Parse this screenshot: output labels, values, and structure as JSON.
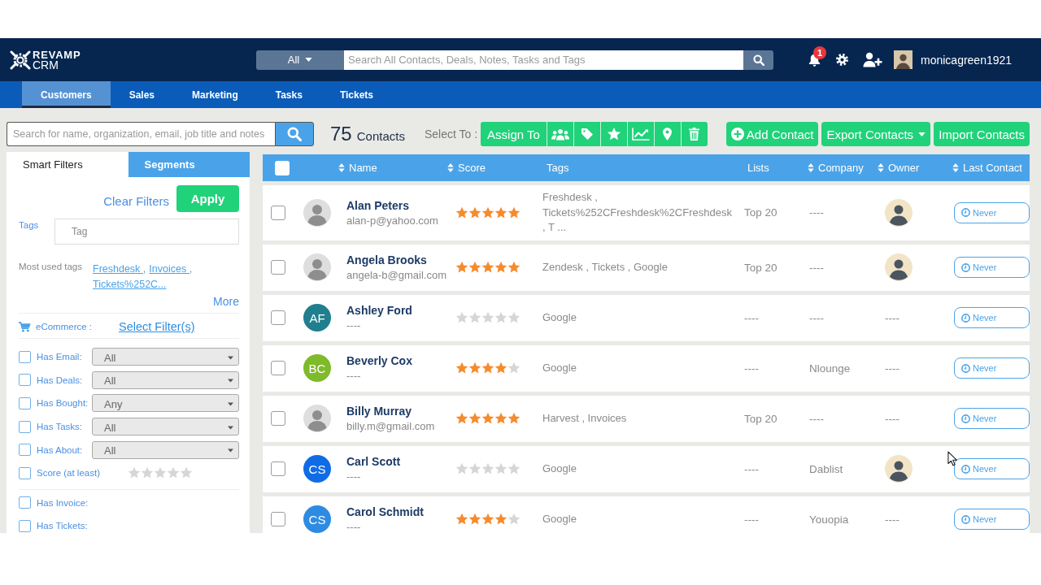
{
  "header": {
    "logo": {
      "line1": "REVAMP",
      "line2": "CRM"
    },
    "search": {
      "scope": "All",
      "placeholder": "Search All Contacts, Deals, Notes, Tasks and Tags"
    },
    "notification_count": "1",
    "username": "monicagreen1921"
  },
  "nav": {
    "tabs": [
      {
        "label": "Customers",
        "selected": true
      },
      {
        "label": "Sales",
        "selected": false
      },
      {
        "label": "Marketing",
        "selected": false
      },
      {
        "label": "Tasks",
        "selected": false
      },
      {
        "label": "Tickets",
        "selected": false
      }
    ]
  },
  "toolbar": {
    "search": {
      "placeholder": "Search for name, organization, email, job title and notes"
    },
    "count": "75",
    "count_label": "Contacts",
    "select_label": "Select To :",
    "assign_label": "Assign To",
    "actions": [
      {
        "kind": "add",
        "label": "Add Contact"
      },
      {
        "kind": "dropdown",
        "label": "Export Contacts"
      },
      {
        "kind": "plain",
        "label": "Import Contacts"
      }
    ]
  },
  "filters": {
    "tabs": [
      {
        "label": "Smart Filters",
        "selected": true
      },
      {
        "label": "Segments",
        "selected": false
      }
    ],
    "clear_label": "Clear Filters",
    "apply_label": "Apply",
    "tags": {
      "label": "Tags",
      "placeholder": "Tag"
    },
    "most_used": {
      "label": "Most used tags",
      "links": [
        "Freshdesk ,",
        "Invoices ,",
        "Tickets%252C..."
      ]
    },
    "more_label": "More",
    "ecommerce": {
      "label": "eCommerce :",
      "link": "Select Filter(s)"
    },
    "options": [
      {
        "kind": "select",
        "label": "Has Email:",
        "checked": false,
        "value": "All"
      },
      {
        "kind": "select",
        "label": "Has Deals:",
        "checked": false,
        "value": "All"
      },
      {
        "kind": "select",
        "label": "Has Bought:",
        "checked": false,
        "value": "Any"
      },
      {
        "kind": "select",
        "label": "Has Tasks:",
        "checked": false,
        "value": "All"
      },
      {
        "kind": "select",
        "label": "Has About:",
        "checked": false,
        "value": "All"
      },
      {
        "kind": "stars",
        "label": "Score (at least)",
        "checked": false,
        "stars": 0
      }
    ],
    "more_options": [
      {
        "label": "Has Invoice:",
        "checked": false
      },
      {
        "label": "Has Tickets:",
        "checked": false
      }
    ]
  },
  "table": {
    "select_all_checked": false,
    "columns": [
      {
        "label": "Name",
        "sortable": true
      },
      {
        "label": "Score",
        "sortable": true
      },
      {
        "label": "Tags",
        "sortable": false
      },
      {
        "label": "Lists",
        "sortable": false
      },
      {
        "label": "Company",
        "sortable": true
      },
      {
        "label": "Owner",
        "sortable": true
      },
      {
        "label": "Last Contact",
        "sortable": true
      }
    ],
    "rows": [
      {
        "checked": false,
        "avatar": {
          "kind": "photo"
        },
        "name": "Alan Peters",
        "email": "alan-p@yahoo.com",
        "stars": 5,
        "tags": "Freshdesk , Tickets%252CFreshdesk%2CFreshdesk , T ...",
        "lists": "Top 20",
        "company": "----",
        "owner": {
          "kind": "photo"
        },
        "last_contact": "Never"
      },
      {
        "checked": false,
        "avatar": {
          "kind": "photo"
        },
        "name": "Angela Brooks",
        "email": "angela-b@gmail.com",
        "stars": 5,
        "tags": "Zendesk , Tickets , Google",
        "lists": "Top 20",
        "company": "----",
        "owner": {
          "kind": "photo"
        },
        "last_contact": "Never"
      },
      {
        "checked": false,
        "avatar": {
          "kind": "initials",
          "text": "AF",
          "color": "#1f7f8e"
        },
        "name": "Ashley Ford",
        "email": "----",
        "stars": 0,
        "tags": "Google",
        "lists": "----",
        "company": "----",
        "owner": {
          "kind": "text",
          "text": "----"
        },
        "last_contact": "Never"
      },
      {
        "checked": false,
        "avatar": {
          "kind": "initials",
          "text": "BC",
          "color": "#7fba2b"
        },
        "name": "Beverly Cox",
        "email": "----",
        "stars": 4,
        "tags": "Google",
        "lists": "----",
        "company": "Nlounge",
        "owner": {
          "kind": "text",
          "text": "----"
        },
        "last_contact": "Never"
      },
      {
        "checked": false,
        "avatar": {
          "kind": "photo"
        },
        "name": "Billy Murray",
        "email": "billy.m@gmail.com",
        "stars": 5,
        "tags": "Harvest , Invoices",
        "lists": "Top 20",
        "company": "----",
        "owner": {
          "kind": "text",
          "text": "----"
        },
        "last_contact": "Never"
      },
      {
        "checked": false,
        "avatar": {
          "kind": "initials",
          "text": "CS",
          "color": "#106ce6"
        },
        "name": "Carl Scott",
        "email": "----",
        "stars": 0,
        "tags": "Google",
        "lists": "----",
        "company": "Dablist",
        "owner": {
          "kind": "photo"
        },
        "last_contact": "Never"
      },
      {
        "checked": false,
        "avatar": {
          "kind": "initials",
          "text": "CS",
          "color": "#2e8be2"
        },
        "name": "Carol Schmidt",
        "email": "----",
        "stars": 4,
        "tags": "Google",
        "lists": "----",
        "company": "Youopia",
        "owner": {
          "kind": "text",
          "text": "----"
        },
        "last_contact": "Never"
      }
    ]
  }
}
